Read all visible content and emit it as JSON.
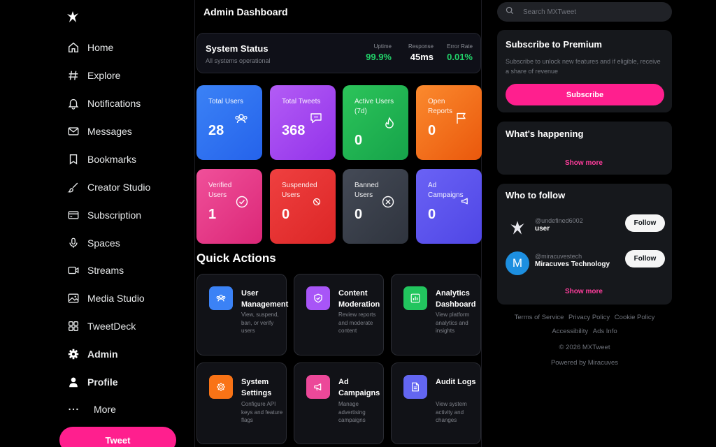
{
  "sidebar": {
    "logo_icon": "star-bird-logo",
    "items": [
      {
        "label": "Home",
        "icon": "home-icon"
      },
      {
        "label": "Explore",
        "icon": "hashtag-icon"
      },
      {
        "label": "Notifications",
        "icon": "bell-icon"
      },
      {
        "label": "Messages",
        "icon": "envelope-icon"
      },
      {
        "label": "Bookmarks",
        "icon": "bookmark-icon"
      },
      {
        "label": "Creator Studio",
        "icon": "brush-icon"
      },
      {
        "label": "Subscription",
        "icon": "card-icon"
      },
      {
        "label": "Spaces",
        "icon": "microphone-icon"
      },
      {
        "label": "Streams",
        "icon": "video-icon"
      },
      {
        "label": "Media Studio",
        "icon": "image-icon"
      },
      {
        "label": "TweetDeck",
        "icon": "grid-icon"
      },
      {
        "label": "Admin",
        "icon": "gear-icon"
      },
      {
        "label": "Profile",
        "icon": "user-icon"
      },
      {
        "label": "More",
        "icon": "more-dots-icon"
      }
    ],
    "tweet_label": "Tweet"
  },
  "main": {
    "title": "Admin Dashboard",
    "status": {
      "title": "System Status",
      "subtitle": "All systems operational",
      "metrics": [
        {
          "label": "Uptime",
          "value": "99.9%",
          "color": "#22d36a"
        },
        {
          "label": "Response",
          "value": "45ms",
          "color": "#ffffff"
        },
        {
          "label": "Error Rate",
          "value": "0.01%",
          "color": "#22d36a"
        }
      ]
    },
    "stats": [
      {
        "label": "Total Users",
        "value": "28",
        "color": "#3a7bff",
        "icon": "users-icon"
      },
      {
        "label": "Total Tweets",
        "value": "368",
        "color": "#a94df2",
        "icon": "chat-icon"
      },
      {
        "label": "Active Users (7d)",
        "value": "0",
        "color": "#22b84f",
        "icon": "flame-icon"
      },
      {
        "label": "Open Reports",
        "value": "0",
        "color": "#f97316",
        "icon": "flag-icon"
      },
      {
        "label": "Verified Users",
        "value": "1",
        "color": "#ec3f8c",
        "icon": "check-circle-icon"
      },
      {
        "label": "Suspended Users",
        "value": "0",
        "color": "#e5322f",
        "icon": "ban-icon"
      },
      {
        "label": "Banned Users",
        "value": "0",
        "color": "#3a3f4a",
        "icon": "x-circle-icon"
      },
      {
        "label": "Ad Campaigns",
        "value": "0",
        "color": "#5b55ea",
        "icon": "megaphone-icon"
      }
    ],
    "quick_actions_title": "Quick Actions",
    "quick_actions": [
      {
        "name": "User Management",
        "desc": "View, suspend, ban, or verify users",
        "color": "#3a7bff",
        "icon": "users-icon"
      },
      {
        "name": "Content Moderation",
        "desc": "Review reports and moderate content",
        "color": "#a94df2",
        "icon": "shield-icon"
      },
      {
        "name": "Analytics Dashboard",
        "desc": "View platform analytics and insights",
        "color": "#22b84f",
        "icon": "bar-chart-icon"
      },
      {
        "name": "System Settings",
        "desc": "Configure API keys and feature flags",
        "color": "#f97316",
        "icon": "gear-icon"
      },
      {
        "name": "Ad Campaigns",
        "desc": "Manage advertising campaigns",
        "color": "#ec3f8c",
        "icon": "megaphone-icon"
      },
      {
        "name": "Audit Logs",
        "desc": "View system activity and changes",
        "color": "#5b55ea",
        "icon": "document-icon"
      }
    ]
  },
  "right": {
    "search": {
      "placeholder": "Search MXTweet"
    },
    "premium": {
      "title": "Subscribe to Premium",
      "desc": "Subscribe to unlock new features and if eligible, receive a share of revenue",
      "button": "Subscribe"
    },
    "happening": {
      "title": "What's happening",
      "show_more": "Show more"
    },
    "follow": {
      "title": "Who to follow",
      "people": [
        {
          "handle": "@undefined6002",
          "name": "user",
          "avatar": "star-bird-logo",
          "button": "Follow"
        },
        {
          "handle": "@miracuvestech",
          "name": "Miracuves Technology",
          "avatar_letter": "M",
          "button": "Follow"
        }
      ],
      "show_more": "Show more"
    },
    "footer": {
      "links1": [
        "Terms of Service",
        "Privacy Policy",
        "Cookie Policy"
      ],
      "links2": [
        "Accessibility",
        "Ads Info"
      ],
      "copyright": "© 2026 MXTweet",
      "powered": "Powered by Miracuves"
    }
  }
}
